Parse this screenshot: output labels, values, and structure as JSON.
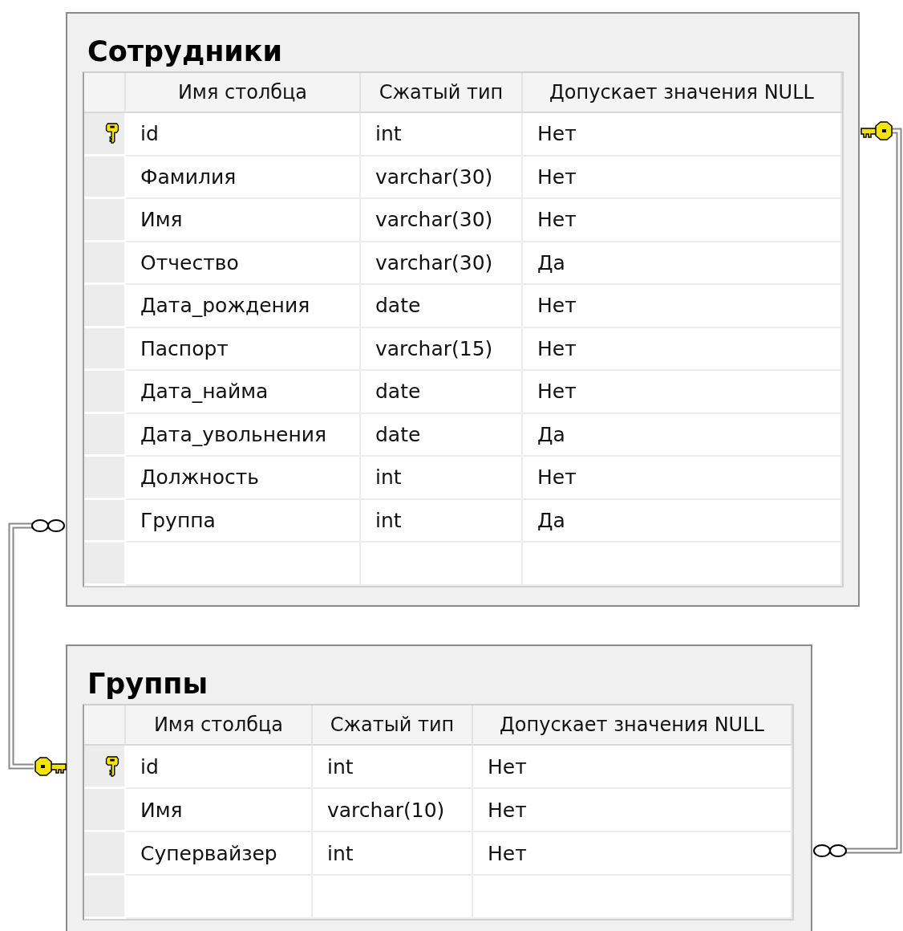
{
  "tables": [
    {
      "title": "Сотрудники",
      "columns": [
        "Имя столбца",
        "Сжатый тип",
        "Допускает значения NULL"
      ],
      "rows": [
        {
          "name": "id",
          "type": "int",
          "nullable": "Нет",
          "primary_key": true
        },
        {
          "name": "Фамилия",
          "type": "varchar(30)",
          "nullable": "Нет",
          "primary_key": false
        },
        {
          "name": "Имя",
          "type": "varchar(30)",
          "nullable": "Нет",
          "primary_key": false
        },
        {
          "name": "Отчество",
          "type": "varchar(30)",
          "nullable": "Да",
          "primary_key": false
        },
        {
          "name": "Дата_рождения",
          "type": "date",
          "nullable": "Нет",
          "primary_key": false
        },
        {
          "name": "Паспорт",
          "type": "varchar(15)",
          "nullable": "Нет",
          "primary_key": false
        },
        {
          "name": "Дата_найма",
          "type": "date",
          "nullable": "Нет",
          "primary_key": false
        },
        {
          "name": "Дата_увольнения",
          "type": "date",
          "nullable": "Да",
          "primary_key": false
        },
        {
          "name": "Должность",
          "type": "int",
          "nullable": "Нет",
          "primary_key": false
        },
        {
          "name": "Группа",
          "type": "int",
          "nullable": "Да",
          "primary_key": false
        }
      ]
    },
    {
      "title": "Группы",
      "columns": [
        "Имя столбца",
        "Сжатый тип",
        "Допускает значения NULL"
      ],
      "rows": [
        {
          "name": "id",
          "type": "int",
          "nullable": "Нет",
          "primary_key": true
        },
        {
          "name": "Имя",
          "type": "varchar(10)",
          "nullable": "Нет",
          "primary_key": false
        },
        {
          "name": "Супервайзер",
          "type": "int",
          "nullable": "Нет",
          "primary_key": false
        }
      ]
    }
  ]
}
